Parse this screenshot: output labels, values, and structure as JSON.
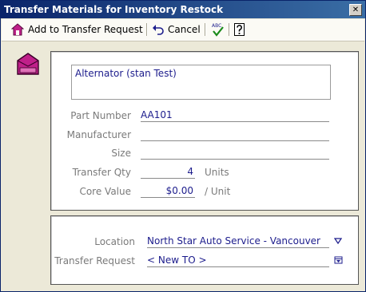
{
  "window": {
    "title": "Transfer Materials for Inventory Restock",
    "close_glyph": "✕"
  },
  "toolbar": {
    "add_label": "Add to Transfer Request",
    "cancel_label": "Cancel",
    "add_icon": "house-add-icon",
    "cancel_icon": "undo-arrow-icon",
    "spell_icon": "spellcheck-icon",
    "help_icon": "help-icon"
  },
  "sidebar": {
    "icon": "inventory-package-icon"
  },
  "part": {
    "description": "Alternator (stan Test)",
    "part_number_label": "Part Number",
    "part_number": "AA101",
    "manufacturer_label": "Manufacturer",
    "manufacturer": "",
    "size_label": "Size",
    "size": "",
    "transfer_qty_label": "Transfer Qty",
    "transfer_qty": "4",
    "transfer_qty_unit": "Units",
    "core_value_label": "Core Value",
    "core_value": "$0.00",
    "core_value_unit": "/ Unit"
  },
  "transfer": {
    "location_label": "Location",
    "location": "North Star Auto Service - Vancouver",
    "request_label": "Transfer Request",
    "request": "< New TO >"
  },
  "colors": {
    "title_bar_start": "#0a246a",
    "title_bar_end": "#3a6ea5",
    "value_text": "#1c1c8c",
    "label_text": "#7a7a7a",
    "icon_magenta": "#c0208a"
  }
}
